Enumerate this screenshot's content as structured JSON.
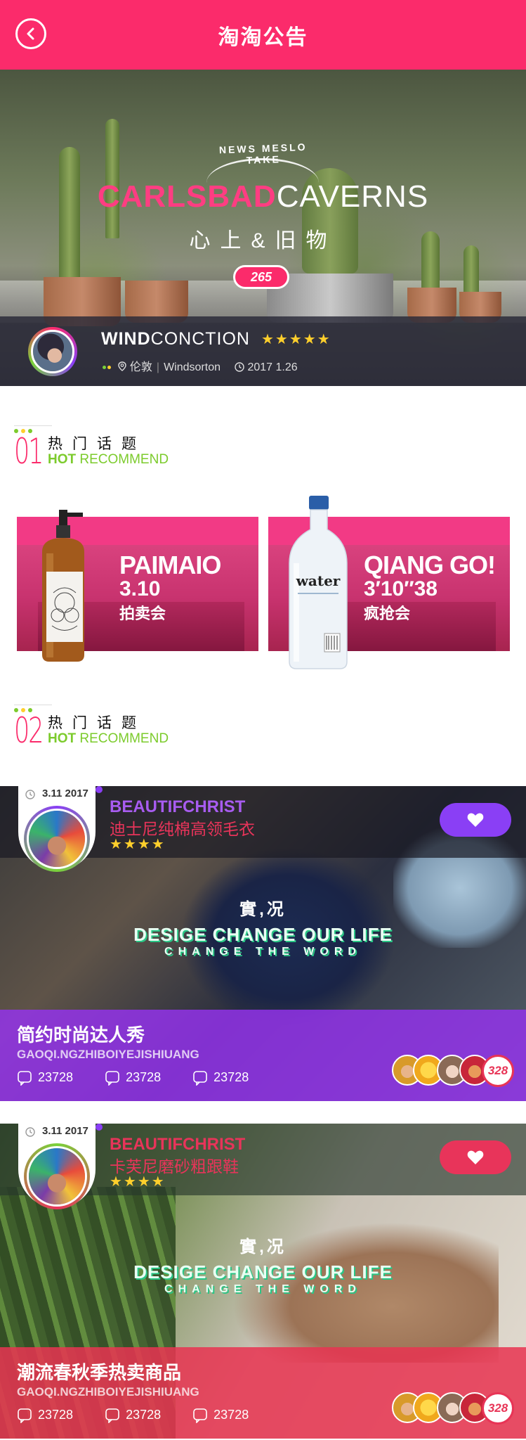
{
  "header": {
    "title": "淘淘公告",
    "back_icon": "back-arrow-icon"
  },
  "hero": {
    "arc_text": "NEWS MESLO TAKE",
    "title_pink": "CARLSBAD",
    "title_white": "CAVERNS",
    "subtitle": "心上&旧物",
    "count": "265",
    "user": {
      "name_bold": "WIND",
      "name_rest": "CONCTION",
      "stars": "★★★★★",
      "location": "伦敦",
      "location_en": "Windsorton",
      "date": "2017 1.26"
    }
  },
  "section1": {
    "num": "01",
    "title": "热门话题",
    "sub_bold": "HOT",
    "sub_rest": " RECOMMEND"
  },
  "section2": {
    "num": "02",
    "title": "热门话题",
    "sub_bold": "HOT",
    "sub_rest": " RECOMMEND"
  },
  "products": [
    {
      "name": "PAIMAIO",
      "time": "3.10",
      "cn": "拍卖会"
    },
    {
      "name": "QIANG GO!",
      "time": "3′10″38",
      "cn": "疯抢会",
      "bottle_label": "water"
    }
  ],
  "features": [
    {
      "date": "3.11 2017",
      "brand": "BEAUTIFCHRIST",
      "product": "迪士尼纯棉高领毛衣",
      "stars": "★★★★",
      "center_1": "實,况",
      "center_2": "DESIGE CHANGE OUR LIFE",
      "center_3": "CHANGE THE WORD",
      "title": "简约时尚达人秀",
      "subtitle": "GAOQI.NGZHIBOIYEJISHIUANG",
      "stats": [
        "23728",
        "23728",
        "23728"
      ],
      "avatar_count": "328",
      "brand_color": "#a85cf0",
      "accent_color": "#8a3ff5"
    },
    {
      "date": "3.11 2017",
      "brand": "BEAUTIFCHRIST",
      "product": "卡芙尼磨砂粗跟鞋",
      "stars": "★★★★",
      "center_1": "實,况",
      "center_2": "DESIGE CHANGE OUR LIFE",
      "center_3": "CHANGE THE WORD",
      "title": "潮流春秋季热卖商品",
      "subtitle": "GAOQI.NGZHIBOIYEJISHIUANG",
      "stats": [
        "23728",
        "23728",
        "23728"
      ],
      "avatar_count": "328",
      "brand_color": "#e8345a",
      "accent_color": "#e8345a"
    }
  ],
  "colors": {
    "primary": "#fb2b6b",
    "green": "#7ccb2c",
    "purple": "#8a3ff5",
    "star": "#ffcf2c"
  }
}
